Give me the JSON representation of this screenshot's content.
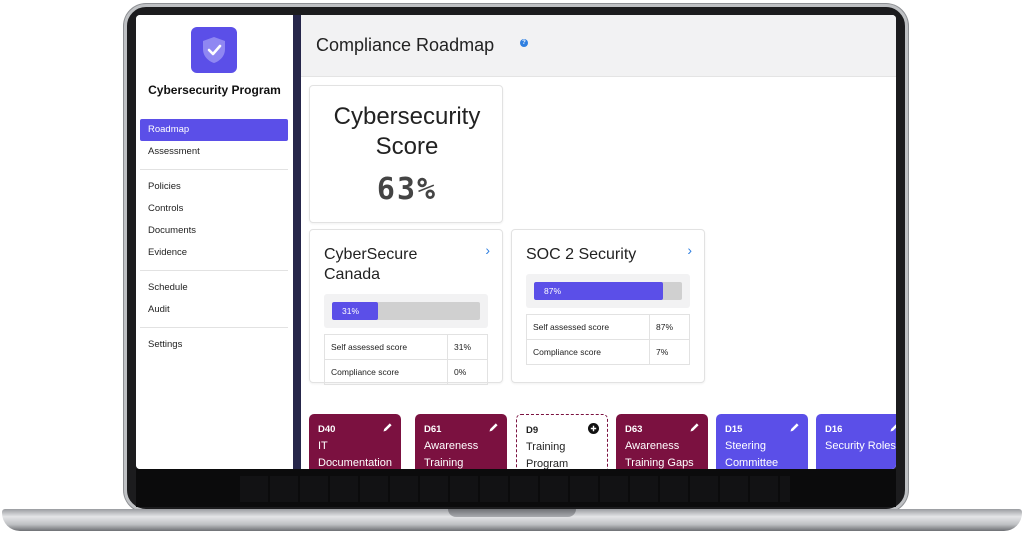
{
  "sidebar": {
    "program_title": "Cybersecurity Program",
    "logo_icon": "shield-check-icon",
    "groups": [
      [
        "Roadmap",
        "Assessment"
      ],
      [
        "Policies",
        "Controls",
        "Documents",
        "Evidence"
      ],
      [
        "Schedule",
        "Audit"
      ],
      [
        "Settings"
      ]
    ],
    "active_item": "Roadmap"
  },
  "header": {
    "title": "Compliance Roadmap",
    "help_icon": "help-icon"
  },
  "score": {
    "label": "Cybersecurity Score",
    "value": "63%"
  },
  "frameworks": [
    {
      "title": "CyberSecure Canada",
      "progress_label": "31%",
      "progress": 0.31,
      "rows": [
        {
          "label": "Self assessed score",
          "value": "31%"
        },
        {
          "label": "Compliance score",
          "value": "0%"
        }
      ]
    },
    {
      "title": "SOC 2 Security",
      "progress_label": "87%",
      "progress": 0.87,
      "rows": [
        {
          "label": "Self assessed score",
          "value": "87%"
        },
        {
          "label": "Compliance score",
          "value": "7%"
        }
      ]
    }
  ],
  "tasks": [
    {
      "id": "D40",
      "name": "IT Documentation",
      "style": "maroon",
      "icon": "edit-icon"
    },
    {
      "id": "D61",
      "name": "Awareness Training",
      "style": "maroon",
      "icon": "edit-icon"
    },
    {
      "id": "D9",
      "name": "Training Program",
      "style": "dashed",
      "icon": "add-icon"
    },
    {
      "id": "D63",
      "name": "Awareness Training Gaps",
      "style": "maroon",
      "icon": "edit-icon"
    },
    {
      "id": "D15",
      "name": "Steering Committee",
      "style": "purple",
      "icon": "edit-icon"
    },
    {
      "id": "D16",
      "name": "Security Roles",
      "style": "purple",
      "icon": "edit-icon"
    }
  ],
  "colors": {
    "accent": "#5b4fe8",
    "maroon": "#7b1140",
    "link": "#2f7fe0"
  }
}
